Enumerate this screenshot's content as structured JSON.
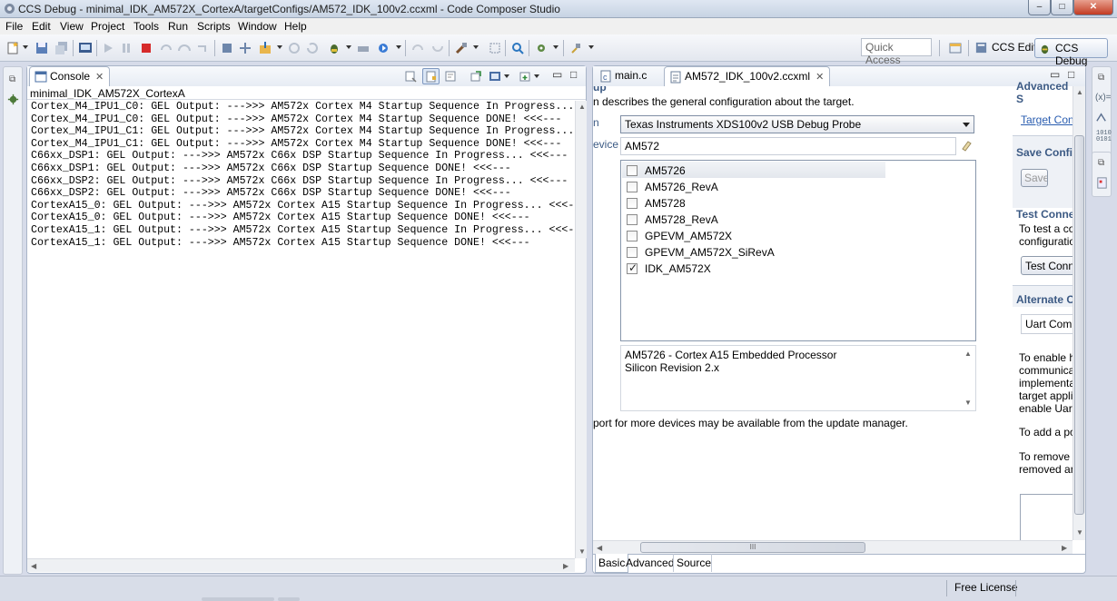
{
  "window": {
    "title": "CCS Debug - minimal_IDK_AM572X_CortexA/targetConfigs/AM572_IDK_100v2.ccxml - Code Composer Studio",
    "minimize": "–",
    "maximize": "□",
    "close": "✕"
  },
  "menu": [
    "File",
    "Edit",
    "View",
    "Project",
    "Tools",
    "Run",
    "Scripts",
    "Window",
    "Help"
  ],
  "toolbar": {
    "quick_access_placeholder": "Quick Access",
    "perspective_edit": "CCS Edit",
    "perspective_debug": "CCS Debug"
  },
  "console": {
    "tab_label": "Console",
    "subtitle": "minimal_IDK_AM572X_CortexA",
    "lines": [
      "Cortex_M4_IPU1_C0: GEL Output: --->>> AM572x Cortex M4 Startup Sequence In Progress... <<<---",
      "Cortex_M4_IPU1_C0: GEL Output: --->>> AM572x Cortex M4 Startup Sequence DONE! <<<---",
      "Cortex_M4_IPU1_C1: GEL Output: --->>> AM572x Cortex M4 Startup Sequence In Progress... <<<---",
      "Cortex_M4_IPU1_C1: GEL Output: --->>> AM572x Cortex M4 Startup Sequence DONE! <<<---",
      "C66xx_DSP1: GEL Output: --->>> AM572x C66x DSP Startup Sequence In Progress... <<<---",
      "C66xx_DSP1: GEL Output: --->>> AM572x C66x DSP Startup Sequence DONE! <<<---",
      "C66xx_DSP2: GEL Output: --->>> AM572x C66x DSP Startup Sequence In Progress... <<<---",
      "C66xx_DSP2: GEL Output: --->>> AM572x C66x DSP Startup Sequence DONE! <<<---",
      "CortexA15_0: GEL Output: --->>> AM572x Cortex A15 Startup Sequence In Progress... <<<---",
      "CortexA15_0: GEL Output: --->>> AM572x Cortex A15 Startup Sequence DONE! <<<---",
      "CortexA15_1: GEL Output: --->>> AM572x Cortex A15 Startup Sequence In Progress... <<<---",
      "CortexA15_1: GEL Output: --->>> AM572x Cortex A15 Startup Sequence DONE! <<<---"
    ]
  },
  "editor": {
    "tabs": [
      {
        "label": "main.c"
      },
      {
        "label": "AM572_IDK_100v2.ccxml"
      }
    ],
    "header_fragment": "up",
    "description": "n describes the general configuration about the target.",
    "connection_label": "n",
    "connection_value": "Texas Instruments XDS100v2 USB Debug Probe",
    "device_label": "evice",
    "device_filter": "AM572",
    "devices": [
      {
        "name": "AM5726",
        "checked": false
      },
      {
        "name": "AM5726_RevA",
        "checked": false
      },
      {
        "name": "AM5728",
        "checked": false
      },
      {
        "name": "AM5728_RevA",
        "checked": false
      },
      {
        "name": "GPEVM_AM572X",
        "checked": false
      },
      {
        "name": "GPEVM_AM572X_SiRevA",
        "checked": false
      },
      {
        "name": "IDK_AM572X",
        "checked": true
      }
    ],
    "device_info": [
      "AM5726 - Cortex A15 Embedded Processor",
      "Silicon Revision 2.x"
    ],
    "update_note": "port for more devices may be available from the update manager.",
    "bottom_tabs": [
      "Basic",
      "Advanced",
      "Source"
    ],
    "hscroll_grip": "III"
  },
  "right": {
    "advanced_fragment": "Advanced S",
    "target_link": "Target Conf",
    "save_title": "Save Configu",
    "save_button": "Save",
    "test_title": "Test Connec",
    "test_desc": [
      "To test a cor",
      "configuratio"
    ],
    "test_button": "Test Conne",
    "alt_title": "Alternate Co",
    "alt_select": "Uart Comm",
    "alt_desc": [
      "To enable h",
      "communica",
      "implementa",
      "target applic",
      "enable Uart"
    ],
    "add_text": "To add a po",
    "remove_text": [
      "To remove a",
      "removed an"
    ]
  },
  "status": {
    "license": "Free License"
  }
}
